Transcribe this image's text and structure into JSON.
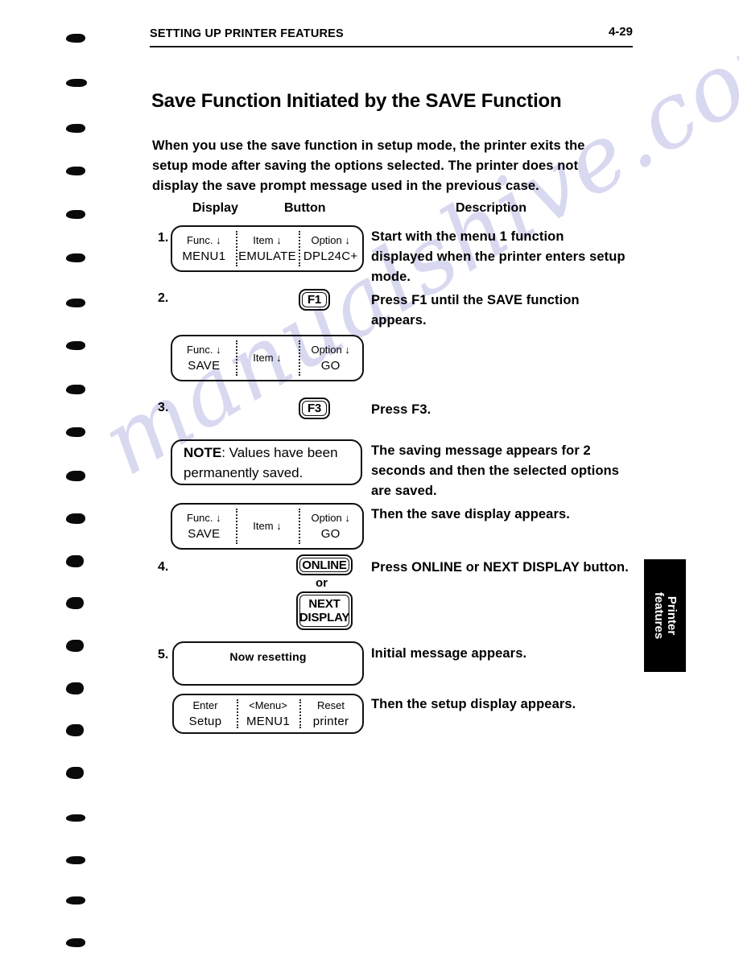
{
  "header": {
    "title": "SETTING UP PRINTER FEATURES",
    "page_number": "4-29"
  },
  "section": {
    "title": "Save Function Initiated by the SAVE Function",
    "intro": "When you use the save function in setup mode, the printer exits the setup mode after saving the options selected. The printer does not display the save prompt message used in the previous case."
  },
  "columns": {
    "display": "Display",
    "button": "Button",
    "description": "Description"
  },
  "steps": [
    {
      "number": "1.",
      "description": "Start with the menu 1 function displayed when the printer enters setup mode."
    },
    {
      "number": "2.",
      "description": "Press F1 until the SAVE function appears."
    },
    {
      "number": "3.",
      "description": "Press F3."
    },
    {
      "number": "4.",
      "description": "Press ONLINE or NEXT DISPLAY button."
    },
    {
      "number": "5.",
      "description": "Initial message appears."
    }
  ],
  "descriptions": {
    "saving_message": "The saving message appears for 2 seconds and then the selected options are saved.",
    "save_display": "Then the save display appears.",
    "setup_display": "Then the setup display appears."
  },
  "panels": {
    "menu1": {
      "cells": [
        {
          "top": "Func.",
          "arrow": "↓",
          "bottom": "MENU1"
        },
        {
          "top": "Item",
          "arrow": "↓",
          "bottom": "EMULATE"
        },
        {
          "top": "Option",
          "arrow": "↓",
          "bottom": "DPL24C+"
        }
      ]
    },
    "save_go_a": {
      "cells": [
        {
          "top": "Func.",
          "arrow": "↓",
          "bottom": "SAVE"
        },
        {
          "top": "Item",
          "arrow": "↓",
          "bottom": ""
        },
        {
          "top": "Option",
          "arrow": "↓",
          "bottom": "GO"
        }
      ]
    },
    "save_go_b": {
      "cells": [
        {
          "top": "Func.",
          "arrow": "↓",
          "bottom": "SAVE"
        },
        {
          "top": "Item",
          "arrow": "↓",
          "bottom": ""
        },
        {
          "top": "Option",
          "arrow": "↓",
          "bottom": "GO"
        }
      ]
    },
    "note": {
      "label": "NOTE",
      "text": ": Values have been permanently saved."
    },
    "resetting": {
      "message": "Now resetting"
    },
    "setup_menu": {
      "cells": [
        {
          "top": "Enter",
          "arrow": "",
          "bottom": "Setup"
        },
        {
          "top": "<Menu>",
          "arrow": "",
          "bottom": "MENU1"
        },
        {
          "top": "Reset",
          "arrow": "",
          "bottom": "printer"
        }
      ]
    }
  },
  "buttons": {
    "f1": "F1",
    "f3": "F3",
    "online": "ONLINE",
    "or": "or",
    "next": "NEXT",
    "display": "DISPLAY"
  },
  "thumb_tab": {
    "line1": "Printer",
    "line2": "features"
  },
  "watermark": {
    "text": "manualshive.com"
  },
  "colors": {
    "ink": "#000000",
    "paper": "#ffffff",
    "tab_background": "#000000",
    "tab_text": "#ffffff",
    "watermark": "#b9bbe4"
  }
}
